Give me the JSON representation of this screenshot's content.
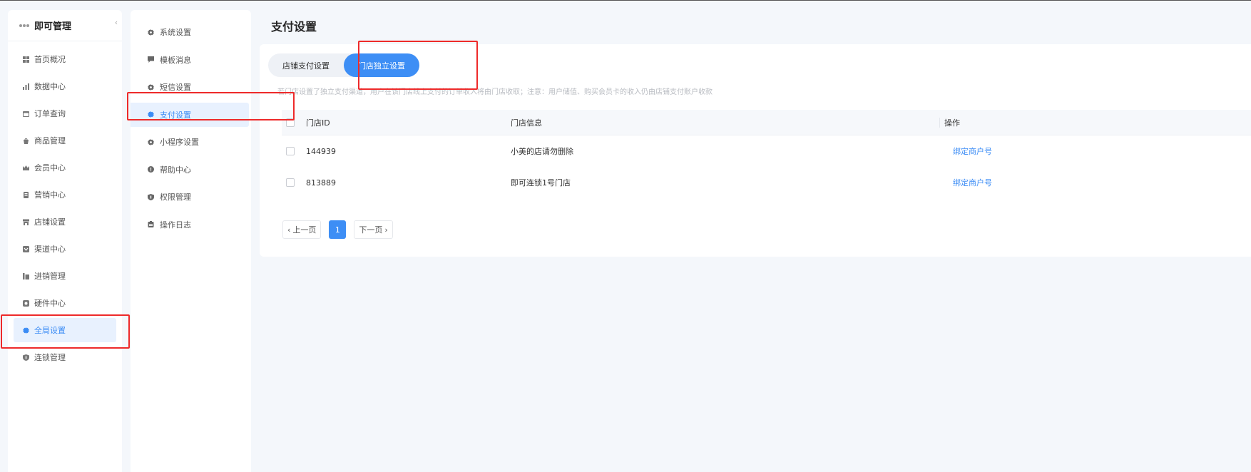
{
  "app": {
    "title": "即可管理"
  },
  "sidebar": {
    "items": [
      {
        "label": "首页概况",
        "icon": "grid-icon",
        "active": false
      },
      {
        "label": "数据中心",
        "icon": "bar-chart-icon",
        "active": false
      },
      {
        "label": "订单查询",
        "icon": "calendar-icon",
        "active": false
      },
      {
        "label": "商品管理",
        "icon": "shop-bag-icon",
        "active": false
      },
      {
        "label": "会员中心",
        "icon": "crown-icon",
        "active": false
      },
      {
        "label": "营销中心",
        "icon": "marketing-icon",
        "active": false
      },
      {
        "label": "店铺设置",
        "icon": "store-icon",
        "active": false
      },
      {
        "label": "渠道中心",
        "icon": "channel-icon",
        "active": false
      },
      {
        "label": "进销管理",
        "icon": "inventory-icon",
        "active": false
      },
      {
        "label": "硬件中心",
        "icon": "hardware-icon",
        "active": false
      },
      {
        "label": "全局设置",
        "icon": "gear-icon",
        "active": true
      },
      {
        "label": "连锁管理",
        "icon": "shield-icon",
        "active": false
      }
    ]
  },
  "subnav": {
    "items": [
      {
        "label": "系统设置",
        "icon": "gear-icon",
        "active": false
      },
      {
        "label": "模板消息",
        "icon": "message-icon",
        "active": false
      },
      {
        "label": "短信设置",
        "icon": "gear-icon",
        "active": false
      },
      {
        "label": "支付设置",
        "icon": "gear-icon",
        "active": true
      },
      {
        "label": "小程序设置",
        "icon": "gear-icon",
        "active": false
      },
      {
        "label": "帮助中心",
        "icon": "help-icon",
        "active": false
      },
      {
        "label": "权限管理",
        "icon": "shield-icon",
        "active": false
      },
      {
        "label": "操作日志",
        "icon": "clipboard-icon",
        "active": false
      }
    ]
  },
  "main": {
    "title": "支付设置",
    "tabs": [
      {
        "label": "店铺支付设置",
        "active": false
      },
      {
        "label": "门店独立设置",
        "active": true
      }
    ],
    "notice": "若门店设置了独立支付渠道，用户在该门店线上支付的订单收入将由门店收取；注意：用户储值、购买会员卡的收入仍由店铺支付账户收款",
    "table": {
      "headers": {
        "id": "门店ID",
        "info": "门店信息",
        "op": "操作"
      },
      "rows": [
        {
          "id": "144939",
          "info": "小美的店请勿删除",
          "op": "绑定商户号"
        },
        {
          "id": "813889",
          "info": "即可连锁1号门店",
          "op": "绑定商户号"
        }
      ]
    },
    "pager": {
      "prev": "上一页",
      "page": "1",
      "next": "下一页"
    }
  },
  "colors": {
    "accent": "#3d8ef5",
    "highlight": "#ee2a2a",
    "background": "#f4f7fb"
  }
}
